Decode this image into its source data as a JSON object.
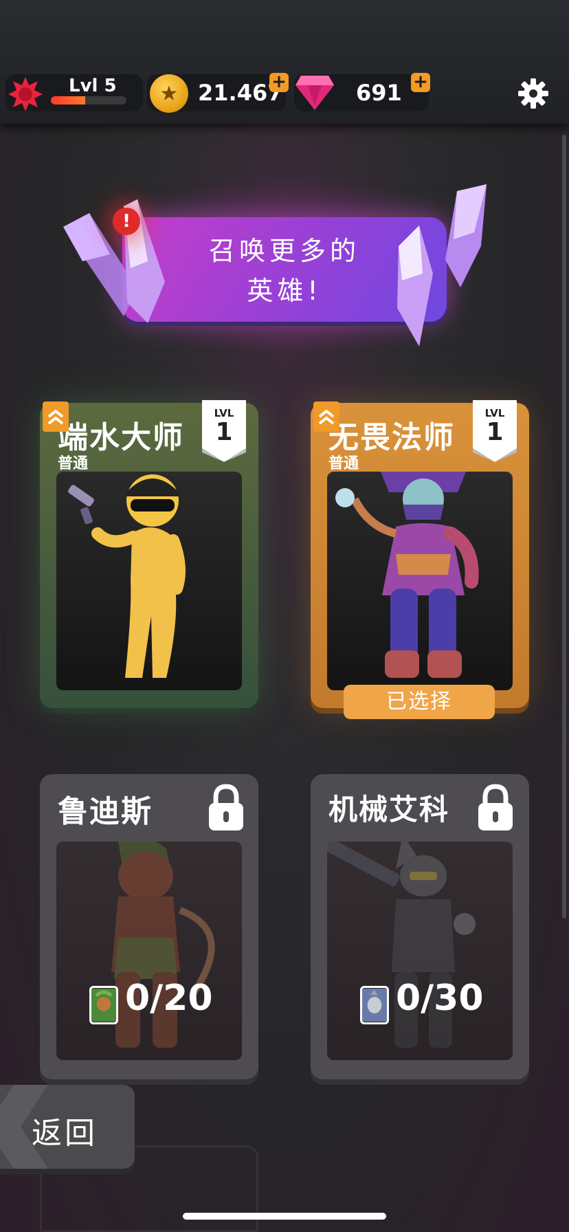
{
  "hud": {
    "level_label": "Lvl 5",
    "level_progress": 0.45,
    "coins": "21.467",
    "gems": "691",
    "plus_symbol": "+"
  },
  "banner": {
    "line1": "召唤更多的",
    "line2": "英雄!",
    "alert": "!"
  },
  "heroes": [
    {
      "name": "端水大师",
      "rarity": "普通",
      "lvl_label": "LVL",
      "level": "1",
      "state": "unlocked",
      "frame_color": "#35503c"
    },
    {
      "name": "无畏法师",
      "rarity": "普通",
      "lvl_label": "LVL",
      "level": "1",
      "state": "selected",
      "selected_label": "已选择",
      "frame_color": "#d9923a"
    },
    {
      "name": "鲁迪斯",
      "state": "locked",
      "progress": "0/20"
    },
    {
      "name": "机械艾科",
      "state": "locked",
      "progress": "0/30"
    }
  ],
  "footer": {
    "back_label": "返回"
  },
  "colors": {
    "accent_orange": "#f59a22",
    "banner_purple": "#9a40d6",
    "coin_gold": "#e59e12",
    "gem_pink": "#e2287a"
  }
}
